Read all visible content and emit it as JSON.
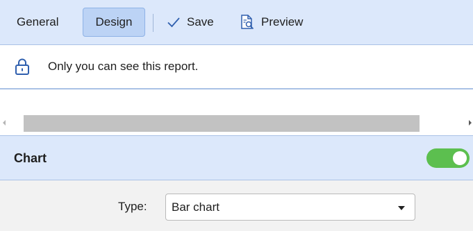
{
  "toolbar": {
    "general_label": "General",
    "design_label": "Design",
    "save_label": "Save",
    "preview_label": "Preview",
    "active_tab": "Design"
  },
  "privacy": {
    "icon": "lock-icon",
    "message": "Only you can see this report."
  },
  "section": {
    "title": "Chart",
    "toggle_on": true,
    "toggle_color": "#5cbf4f"
  },
  "form": {
    "type_label": "Type:",
    "type_value": "Bar chart"
  },
  "colors": {
    "toolbar_bg": "#dce8fb",
    "active_tab_bg": "#bcd3f5",
    "accent_border": "#a9c1e6"
  }
}
